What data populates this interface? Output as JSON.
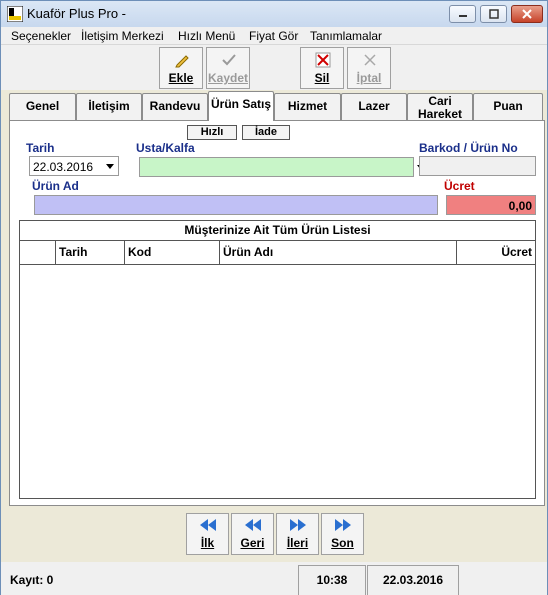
{
  "window": {
    "title": "Kuaför Plus Pro -"
  },
  "menu": [
    "Seçenekler",
    "İletişim Merkezi",
    "Hızlı Menü",
    "Fiyat Gör",
    "Tanımlamalar"
  ],
  "toolbar": {
    "add": "Ekle",
    "save": "Kaydet",
    "delete": "Sil",
    "cancel": "İptal"
  },
  "tabs": [
    "Genel",
    "İletişim",
    "Randevu",
    "Ürün Satış",
    "Hizmet",
    "Lazer",
    "Cari\nHareket",
    "Puan"
  ],
  "active_tab": "Ürün Satış",
  "form": {
    "quick_label": "Hızlı",
    "return_label": "İade",
    "date_label": "Tarih",
    "date_value": "22.03.2016",
    "stylist_label": "Usta/Kalfa",
    "stylist_value": "",
    "barcode_label": "Barkod / Ürün No",
    "barcode_value": "",
    "product_label": "Ürün Ad",
    "product_value": "",
    "price_label": "Ücret",
    "price_value": "0,00",
    "colors": {
      "stylist_bg": "#c8f5c8",
      "product_bg": "#c0c0f5",
      "price_bg": "#f08080"
    }
  },
  "list": {
    "title": "Müşterinize Ait Tüm Ürün Listesi",
    "columns": [
      "",
      "Tarih",
      "Kod",
      "Ürün Adı",
      "Ücret"
    ],
    "rows": []
  },
  "nav": {
    "first": "İlk",
    "prev": "Geri",
    "next": "İleri",
    "last": "Son"
  },
  "status": {
    "record_label": "Kayıt: 0",
    "time": "10:38",
    "date": "22.03.2016"
  }
}
